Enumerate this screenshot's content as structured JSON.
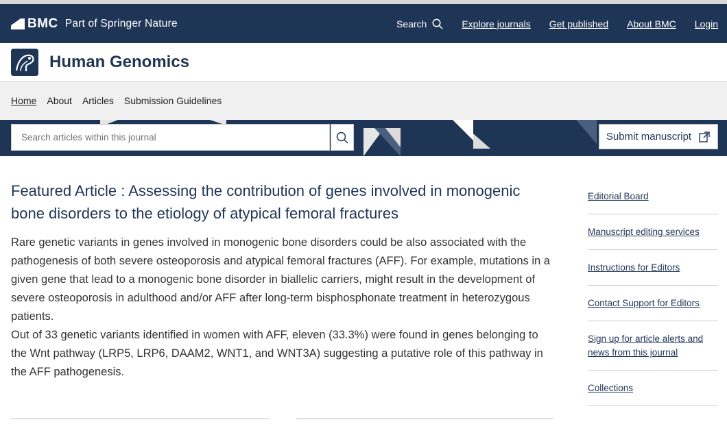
{
  "bmc": {
    "logo_text": "BMC",
    "part_of": "Part of Springer Nature",
    "nav": {
      "search_label": "Search",
      "explore": "Explore journals",
      "get_published": "Get published",
      "about": "About BMC",
      "login": "Login"
    }
  },
  "journal": {
    "title": "Human Genomics"
  },
  "subnav": {
    "home": "Home",
    "about": "About",
    "articles": "Articles",
    "guidelines": "Submission Guidelines"
  },
  "search": {
    "placeholder": "Search articles within this journal"
  },
  "submit": {
    "label": "Submit manuscript"
  },
  "featured": {
    "title": "Featured Article : Assessing the contribution of genes involved in monogenic bone disorders to the etiology of atypical femoral fractures",
    "para1": "Rare genetic variants in genes involved in monogenic bone disorders could be also associated with the pathogenesis of both severe osteoporosis and atypical femoral fractures (AFF). For example, mutations in a given gene that lead to a monogenic bone disorder in biallelic carriers, might result in the development of severe osteoporosis in adulthood and/or AFF after long-term bisphosphonate treatment in heterozygous patients.",
    "para2": "Out of 33 genetic variants identified in women with AFF, eleven (33.3%) were found in genes belonging to the Wnt pathway (LRP5, LRP6, DAAM2, WNT1, and WNT3A) suggesting a putative role of this pathway in the AFF pathogenesis."
  },
  "sidebar": {
    "items": [
      {
        "label": "Editorial Board"
      },
      {
        "label": "Manuscript editing services"
      },
      {
        "label": "Instructions for Editors"
      },
      {
        "label": "Contact Support for Editors"
      },
      {
        "label": "Sign up for article alerts and news from this journal"
      },
      {
        "label": "Collections"
      }
    ]
  },
  "colors": {
    "navy": "#1f3556",
    "light_gray": "#f0f0f0"
  },
  "icons": [
    "bmc-logo-icon",
    "search-icon",
    "journal-logo-icon",
    "external-submit-icon"
  ]
}
